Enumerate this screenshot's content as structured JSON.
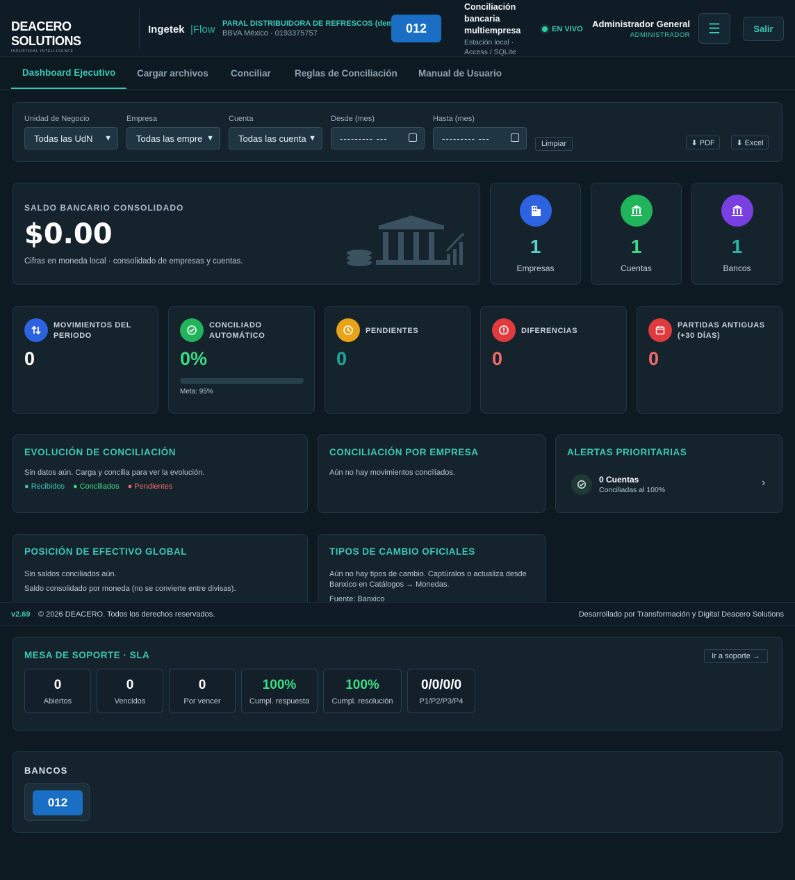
{
  "header": {
    "logo_text": "DEACERO SOLUTIONS",
    "logo_sub": "INDUSTRIAL INTELLIGENCE",
    "product": "Ingetek",
    "product_suffix": "|Flow",
    "company": "PARAL DISTRIBUIDORA DE REFRESCOS (demo)",
    "bank_account": "BBVA México · 0193375757",
    "bank_code": "012",
    "app_title": "Conciliación bancaria multiempresa",
    "app_sub": "Estación local · Access / SQLite",
    "live_label": "EN VIVO",
    "user_name": "Administrador General",
    "user_role": "ADMINISTRADOR",
    "menu_icon": "☰",
    "exit_label": "Salir"
  },
  "tabs": [
    {
      "label": "Dashboard Ejecutivo",
      "active": true
    },
    {
      "label": "Cargar archivos"
    },
    {
      "label": "Conciliar"
    },
    {
      "label": "Reglas de Conciliación"
    },
    {
      "label": "Manual de Usuario"
    }
  ],
  "filters": {
    "unit_label": "Unidad de Negocio",
    "unit_value": "Todas las UdN",
    "company_label": "Empresa",
    "company_value": "Todas las empre",
    "account_label": "Cuenta",
    "account_value": "Todas las cuenta",
    "from_label": "Desde (mes)",
    "from_value": "---------  ---",
    "to_label": "Hasta (mes)",
    "to_value": "---------  ---",
    "clear_label": "Limpiar",
    "pdf_label": "⬇ PDF",
    "excel_label": "⬇ Excel"
  },
  "balance": {
    "label": "SALDO BANCARIO CONSOLIDADO",
    "amount": "$0.00",
    "note": "Cifras en moneda local · consolidado de empresas y cuentas."
  },
  "stats": [
    {
      "value": "1",
      "label": "Empresas",
      "color": "#2d63e0",
      "num_color": "#5fd0c0"
    },
    {
      "value": "1",
      "label": "Cuentas",
      "color": "#22b45a",
      "num_color": "#3ddc84"
    },
    {
      "value": "1",
      "label": "Bancos",
      "color": "#7a3fe0",
      "num_color": "#2bb5a4"
    }
  ],
  "kpis": [
    {
      "title": "MOVIMIENTOS DEL PERIODO",
      "value": "0",
      "color": "#2d63e0",
      "val_color": "#ffffff"
    },
    {
      "title": "CONCILIADO AUTOMÁTICO",
      "value": "0%",
      "color": "#22b45a",
      "val_color": "#3ddc84",
      "meta": "Meta: 95%",
      "progress": 0
    },
    {
      "title": "PENDIENTES",
      "value": "0",
      "color": "#e8a317",
      "val_color": "#1fa59a"
    },
    {
      "title": "DIFERENCIAS",
      "value": "0",
      "color": "#e0393e",
      "val_color": "#f06b6b"
    },
    {
      "title": "PARTIDAS ANTIGUAS (+30 DÍAS)",
      "value": "0",
      "color": "#e0393e",
      "val_color": "#f06b6b"
    }
  ],
  "evolution": {
    "title": "EVOLUCIÓN DE CONCILIACIÓN",
    "empty": "Sin datos aún. Carga y concilia para ver la evolución.",
    "legend": [
      {
        "label": "Recibidos",
        "color": "#3fc7b3"
      },
      {
        "label": "Conciliados",
        "color": "#3ddc84"
      },
      {
        "label": "Pendientes",
        "color": "#f06b6b"
      }
    ]
  },
  "by_company": {
    "title": "CONCILIACIÓN POR EMPRESA",
    "empty": "Aún no hay movimientos conciliados."
  },
  "alerts": {
    "title": "ALERTAS PRIORITARIAS",
    "item_title": "0 Cuentas",
    "item_sub": "Conciliadas al 100%"
  },
  "cash": {
    "title": "POSICIÓN DE EFECTIVO GLOBAL",
    "line1": "Sin saldos conciliados aún.",
    "line2": "Saldo consolidado por moneda (no se convierte entre divisas)."
  },
  "fx": {
    "title": "TIPOS DE CAMBIO OFICIALES",
    "line1": "Aún no hay tipos de cambio. Captúralos o actualiza desde Banxico en Catálogos → Monedas.",
    "source": "Fuente: Banxico"
  },
  "footer": {
    "version": "v2.69",
    "copyright": "© 2026 DEACERO. Todos los derechos reservados.",
    "credit": "Desarrollado por Transformación y Digital Deacero Solutions"
  },
  "sla": {
    "title": "MESA DE SOPORTE · SLA",
    "link": "Ir a soporte →",
    "items": [
      {
        "value": "0",
        "label": "Abiertos"
      },
      {
        "value": "0",
        "label": "Vencidos"
      },
      {
        "value": "0",
        "label": "Por vencer"
      },
      {
        "value": "100%",
        "label": "Cumpl. respuesta",
        "green": true
      },
      {
        "value": "100%",
        "label": "Cumpl. resolución",
        "green": true
      },
      {
        "value": "0/0/0/0",
        "label": "P1/P2/P3/P4"
      }
    ]
  },
  "banks": {
    "title": "BANCOS",
    "items": [
      "012"
    ]
  }
}
